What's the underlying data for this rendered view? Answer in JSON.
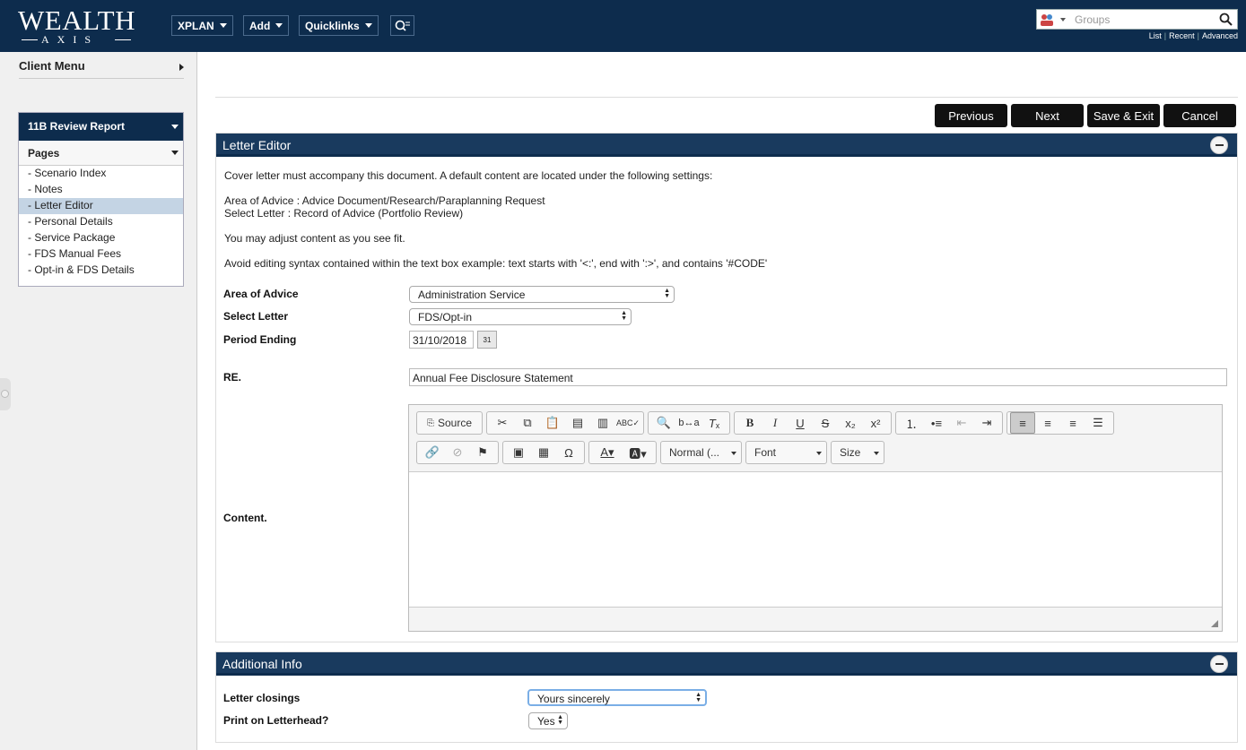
{
  "header": {
    "logo": {
      "main": "WEALTH",
      "sub": "AXIS"
    },
    "nav": [
      "XPLAN",
      "Add",
      "Quicklinks"
    ],
    "search": {
      "placeholder": "Groups",
      "links": [
        "List",
        "Recent",
        "Advanced"
      ]
    }
  },
  "sidebar": {
    "client_menu": "Client Menu",
    "report_title": "11B Review Report",
    "pages_title": "Pages",
    "pages": [
      "- Scenario Index",
      "- Notes",
      "- Letter Editor",
      "- Personal Details",
      "- Service Package",
      "- FDS Manual Fees",
      "- Opt-in & FDS Details"
    ],
    "active_page": "- Letter Editor"
  },
  "actions": {
    "previous": "Previous",
    "next": "Next",
    "save_exit": "Save & Exit",
    "cancel": "Cancel"
  },
  "letter_editor": {
    "title": "Letter Editor",
    "intro": "Cover letter must accompany this document. A default content are located under the following settings:",
    "area_line": "Area of Advice : Advice Document/Research/Paraplanning Request",
    "select_line": "Select Letter : Record of Advice (Portfolio Review)",
    "adjust": "You may adjust content as you see fit.",
    "avoid": "Avoid editing syntax contained within the text box example: text starts with '<:', end with ':>', and contains '#CODE'",
    "fields": {
      "area_label": "Area of Advice",
      "area_value": "Administration Service",
      "letter_label": "Select Letter",
      "letter_value": "FDS/Opt-in",
      "period_label": "Period Ending",
      "period_value": "31/10/2018",
      "re_label": "RE.",
      "re_value": "Annual Fee Disclosure Statement",
      "content_label": "Content."
    },
    "toolbar": {
      "source": "Source",
      "format": "Normal (...",
      "font": "Font",
      "size": "Size"
    }
  },
  "additional_info": {
    "title": "Additional Info",
    "closings_label": "Letter closings",
    "closings_value": "Yours sincerely",
    "letterhead_label": "Print on Letterhead?",
    "letterhead_value": "Yes"
  }
}
